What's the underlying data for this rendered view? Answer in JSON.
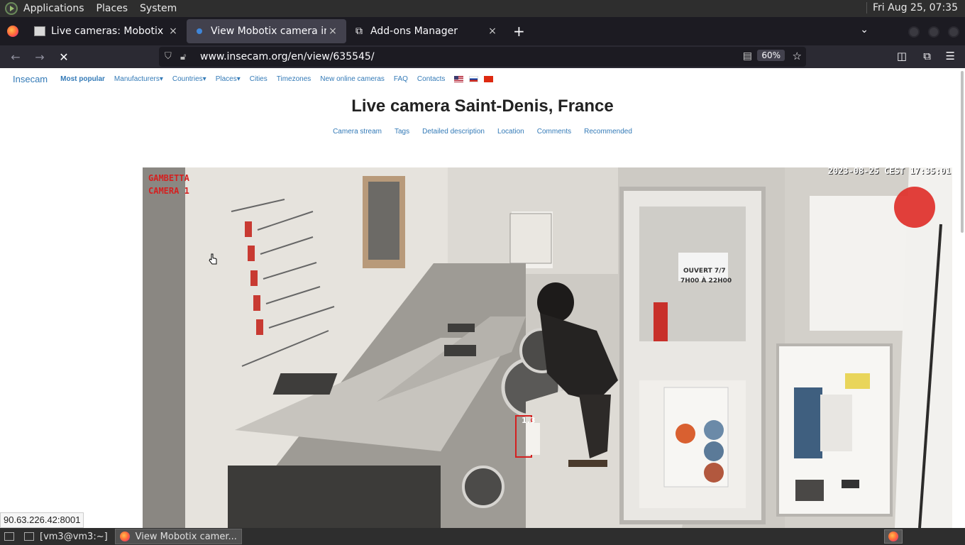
{
  "topbar": {
    "menus": [
      "Applications",
      "Places",
      "System"
    ],
    "clock": "Fri Aug 25, 07:35"
  },
  "browser": {
    "tabs": [
      {
        "label": "Live cameras: Mobotix",
        "close": "×"
      },
      {
        "label": "View Mobotix camera in Fra",
        "close": "×"
      },
      {
        "label": "Add-ons Manager",
        "close": "×"
      }
    ],
    "new_tab": "+",
    "url": "www.insecam.org/en/view/635545/",
    "zoom": "60%"
  },
  "site": {
    "brand": "Insecam",
    "nav": [
      "Most popular",
      "Manufacturers▾",
      "Countries▾",
      "Places▾",
      "Cities",
      "Timezones",
      "New online cameras",
      "FAQ",
      "Contacts"
    ],
    "title": "Live camera Saint-Denis, France",
    "subnav": [
      "Camera stream",
      "Tags",
      "Detailed description",
      "Location",
      "Comments",
      "Recommended"
    ]
  },
  "camera": {
    "name_line1": "GAMBETTA",
    "name_line2": "CAMERA 1",
    "timestamp": "2023-08-25 CEST 17:35:01",
    "box_label": "1.3",
    "sign_text_1": "OUVERT 7/7",
    "sign_text_2": "7H00 À 22H00"
  },
  "status_link": "90.63.226.42:8001",
  "taskbar": {
    "items": [
      "[vm3@vm3:~]",
      "View Mobotix camer..."
    ]
  }
}
